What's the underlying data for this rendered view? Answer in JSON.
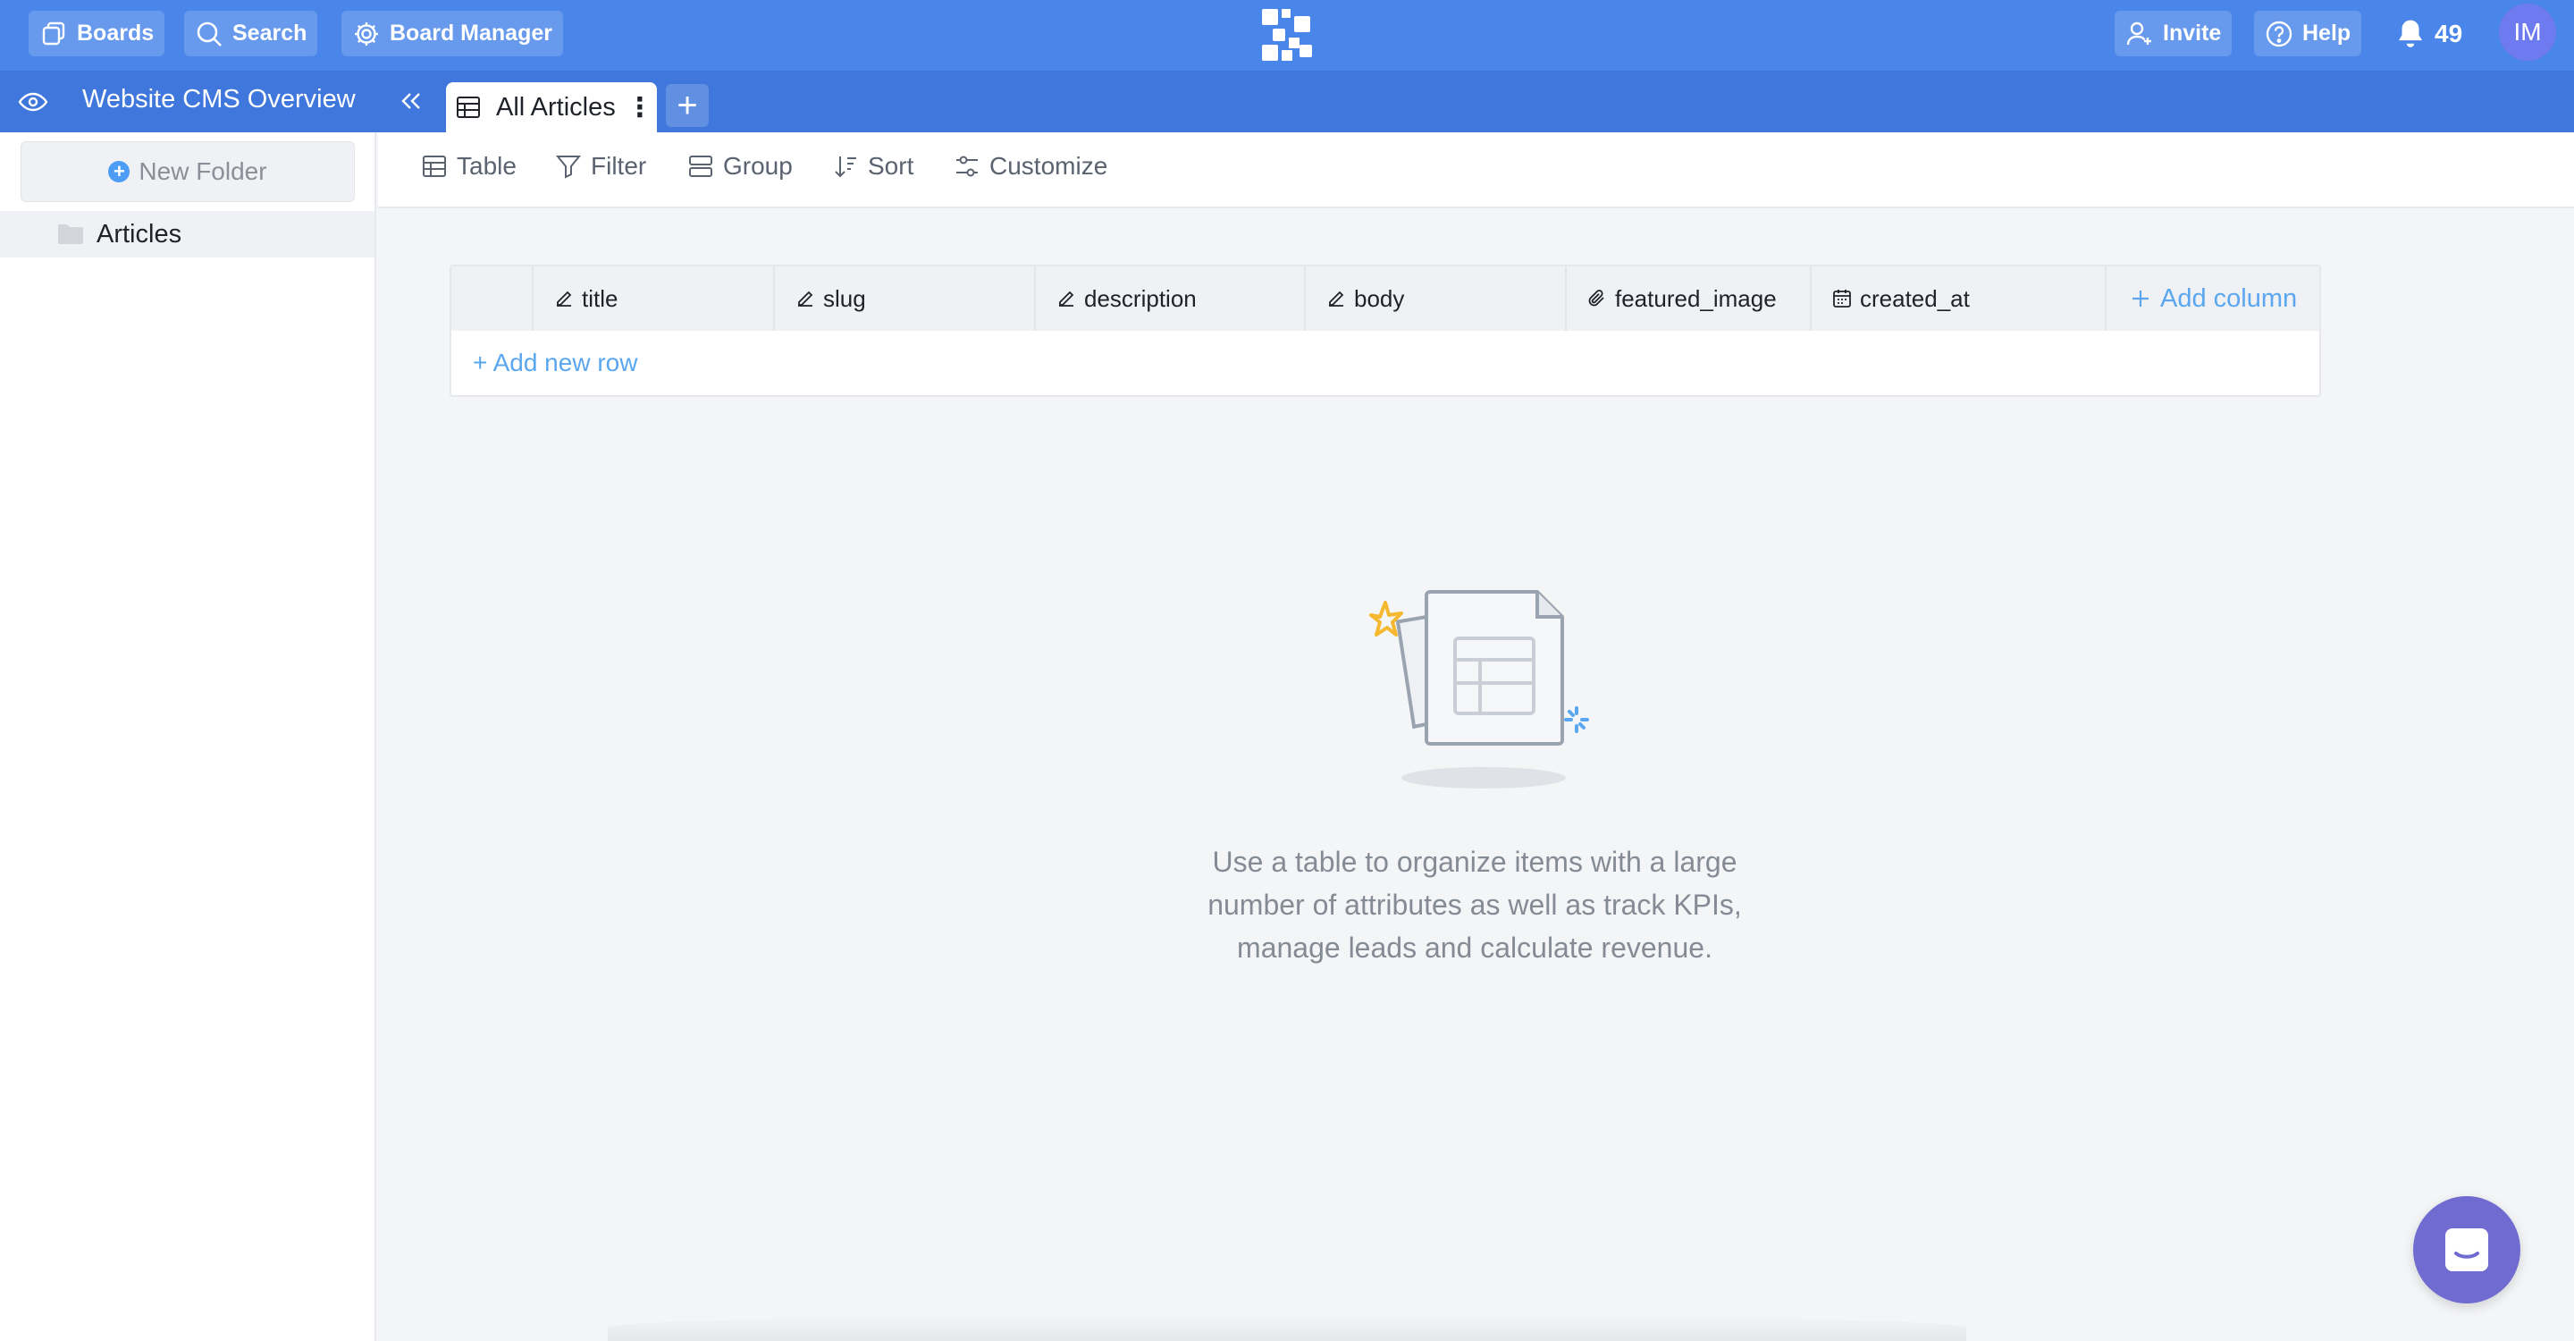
{
  "topbar": {
    "boards_label": "Boards",
    "search_label": "Search",
    "board_manager_label": "Board Manager",
    "invite_label": "Invite",
    "help_label": "Help",
    "notifications_count": "49",
    "avatar_initials": "IM"
  },
  "subbar": {
    "board_title": "Website CMS Overview",
    "active_tab_label": "All Articles",
    "add_tab_symbol": "+"
  },
  "sidebar": {
    "new_folder_label": "New Folder",
    "folders": [
      {
        "label": "Articles"
      }
    ]
  },
  "toolbar": {
    "table_label": "Table",
    "filter_label": "Filter",
    "group_label": "Group",
    "sort_label": "Sort",
    "customize_label": "Customize"
  },
  "table": {
    "columns": [
      {
        "label": "title",
        "icon": "pencil-icon"
      },
      {
        "label": "slug",
        "icon": "pencil-icon"
      },
      {
        "label": "description",
        "icon": "pencil-icon"
      },
      {
        "label": "body",
        "icon": "pencil-icon"
      },
      {
        "label": "featured_image",
        "icon": "paperclip-icon"
      },
      {
        "label": "created_at",
        "icon": "calendar-icon"
      }
    ],
    "add_column_label": "Add column",
    "add_row_label": "+ Add new row"
  },
  "empty_state": {
    "message": "Use a table to organize items with a large number of attributes as well as track KPIs, manage leads and calculate revenue."
  },
  "colors": {
    "topbar": "#4a86ea",
    "subbar": "#3f77dc",
    "link_blue": "#5aa7f0",
    "chat_purple": "#6f6bd1"
  }
}
